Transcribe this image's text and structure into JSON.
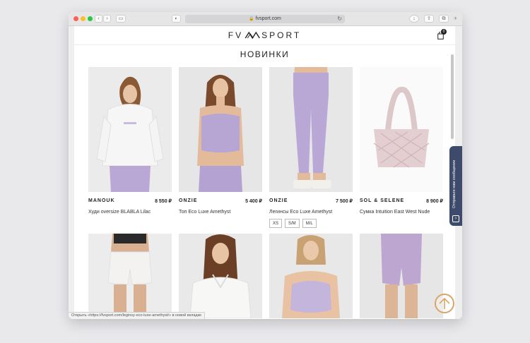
{
  "browser": {
    "url": "fvsport.com",
    "tab_icon": "shield-icon"
  },
  "site": {
    "logo_left": "FV",
    "logo_right": "SPORT",
    "cart_count": "0",
    "section_title": "НОВИНКИ"
  },
  "products": [
    {
      "brand": "MANOUK",
      "price": "8 550 ₽",
      "name": "Худи oversize BLABLA Lilac"
    },
    {
      "brand": "ONZIE",
      "price": "5 400 ₽",
      "name": "Топ Eco Luxe Amethyst"
    },
    {
      "brand": "ONZIE",
      "price": "7 500 ₽",
      "name": "Легинсы Eco Luxe Amethyst",
      "sizes": [
        "XS",
        "S/M",
        "M/L"
      ]
    },
    {
      "brand": "SOL & SELENE",
      "price": "8 900 ₽",
      "name": "Сумка Intuition East West Nude"
    }
  ],
  "chat_tab": {
    "label": "Отправьте нам сообщение"
  },
  "status_bar": {
    "text": "Открыть «https://fvsport.com/leginsy-eco-luxe-amethyst/» в новой вкладке"
  },
  "colors": {
    "accent": "#d8a66a",
    "chat": "#3d4a6b",
    "lilac": "#b9a8d6"
  }
}
